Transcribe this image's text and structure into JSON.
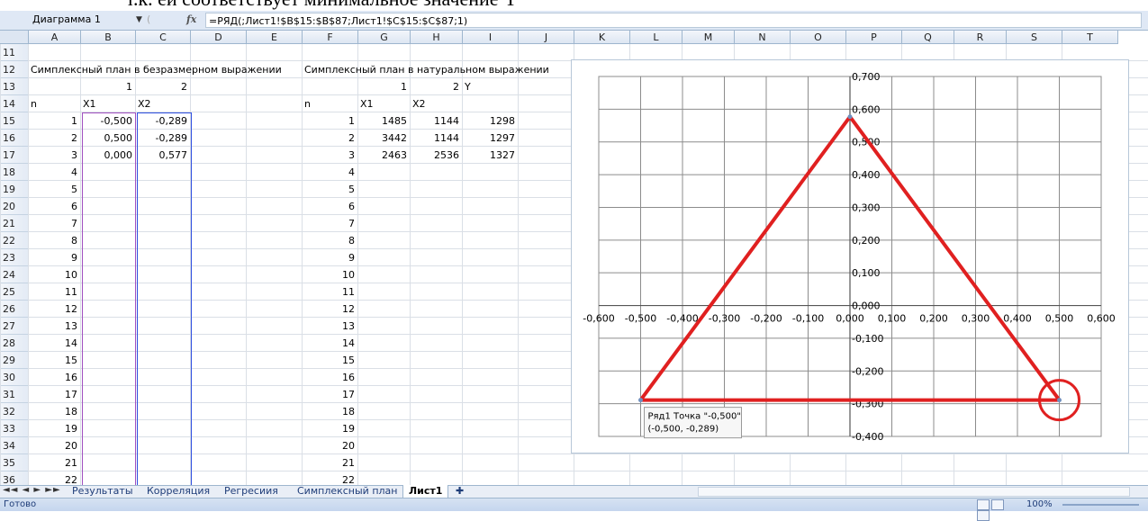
{
  "caption": {
    "text": "т.к. ей соответствует минимальное значение Y"
  },
  "formula_bar": {
    "name_box": "Диаграмма 1",
    "fx": "fx",
    "formula": "=РЯД(;Лист1!$B$15:$B$87;Лист1!$C$15:$C$87;1)"
  },
  "columns": [
    "A",
    "B",
    "C",
    "D",
    "E",
    "F",
    "G",
    "H",
    "I",
    "J",
    "K",
    "L",
    "M",
    "N",
    "O",
    "P",
    "Q",
    "R",
    "S",
    "T"
  ],
  "rows": [
    "11",
    "12",
    "13",
    "14",
    "15",
    "16",
    "17",
    "18",
    "19",
    "20",
    "21",
    "22",
    "23",
    "24",
    "25",
    "26",
    "27",
    "28",
    "29",
    "30",
    "31",
    "32",
    "33",
    "34",
    "35",
    "36"
  ],
  "sheet": {
    "title_dimless": "Симплексный план в безразмерном выражении",
    "title_natural": "Симплексный план в натуральном выражении",
    "left_factor_nums": [
      "1",
      "2"
    ],
    "right_factor_nums": [
      "1",
      "2"
    ],
    "y_hdr13": "Y",
    "hdr_n": "n",
    "hdr_x1": "X1",
    "hdr_x2": "X2",
    "left_n": [
      "1",
      "2",
      "3",
      "4",
      "5",
      "6",
      "7",
      "8",
      "9",
      "10",
      "11",
      "12",
      "13",
      "14",
      "15",
      "16",
      "17",
      "18",
      "19",
      "20",
      "21",
      "22"
    ],
    "left_x1": [
      "-0,500",
      "0,500",
      "0,000"
    ],
    "left_x2": [
      "-0,289",
      "-0,289",
      "0,577"
    ],
    "right_n": [
      "1",
      "2",
      "3",
      "4",
      "5",
      "6",
      "7",
      "8",
      "9",
      "10",
      "11",
      "12",
      "13",
      "14",
      "15",
      "16",
      "17",
      "18",
      "19",
      "20",
      "21",
      "22"
    ],
    "right_x1": [
      "1485",
      "3442",
      "2463"
    ],
    "right_x2": [
      "1144",
      "1144",
      "2536"
    ],
    "right_y": [
      "1298",
      "1297",
      "1327"
    ]
  },
  "chart_data": {
    "type": "scatter",
    "series": [
      {
        "points": [
          [
            -0.5,
            -0.289
          ],
          [
            0.5,
            -0.289
          ],
          [
            0.0,
            0.577
          ],
          [
            -0.5,
            -0.289
          ]
        ],
        "color": "#e02020"
      }
    ],
    "xlim": [
      -0.6,
      0.6
    ],
    "ylim": [
      -0.4,
      0.7
    ],
    "x_ticks": [
      "-0,600",
      "-0,500",
      "-0,400",
      "-0,300",
      "-0,200",
      "-0,100",
      "0,000",
      "0,100",
      "0,200",
      "0,300",
      "0,400",
      "0,500",
      "0,600"
    ],
    "y_ticks": [
      "0,700",
      "0,600",
      "0,500",
      "0,400",
      "0,300",
      "0,200",
      "0,100",
      "0,000",
      "-0,100",
      "-0,200",
      "-0,300",
      "-0,400"
    ],
    "grid": true,
    "highlight_point": [
      0.5,
      -0.289
    ],
    "tooltip_line1": "Ряд1 Точка \"-0,500\"",
    "tooltip_line2": "(-0,500, -0,289)"
  },
  "tabs": {
    "nav": "◄◄ ◄ ► ►►",
    "items": [
      "Результаты",
      "Корреляция",
      "Регресиия",
      "Симплексный план",
      "Лист1"
    ],
    "active": "Лист1"
  },
  "status": {
    "ready": "Готово",
    "zoom": "100%"
  }
}
